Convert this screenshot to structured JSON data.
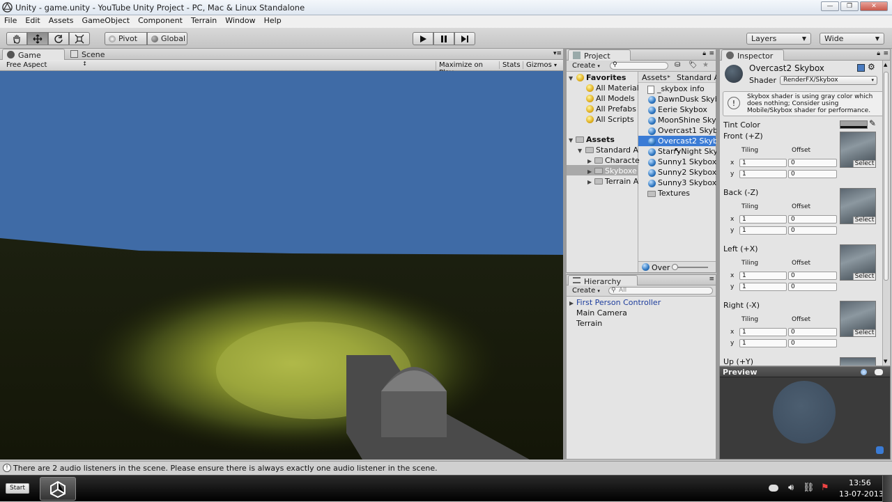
{
  "window": {
    "title": "Unity - game.unity - YouTube Unity Project - PC, Mac & Linux Standalone",
    "controls": [
      "—",
      "❐",
      "✕"
    ]
  },
  "menu": [
    "File",
    "Edit",
    "Assets",
    "GameObject",
    "Component",
    "Terrain",
    "Window",
    "Help"
  ],
  "toolbar": {
    "pivot": "Pivot",
    "global": "Global",
    "layers": "Layers",
    "layout": "Wide"
  },
  "game_panel": {
    "tab_game": "Game",
    "tab_scene": "Scene",
    "aspect": "Free Aspect",
    "maximize": "Maximize on Play",
    "stats": "Stats",
    "gizmos": "Gizmos"
  },
  "project": {
    "tab": "Project",
    "create": "Create",
    "favorites_label": "Favorites",
    "favorites": [
      "All Material",
      "All Models",
      "All Prefabs",
      "All Scripts"
    ],
    "assets_label": "Assets",
    "tree": [
      "Standard A",
      "Characte",
      "Skyboxe",
      "Terrain A"
    ],
    "breadcrumb": [
      "Assets",
      "Standard A"
    ],
    "files": [
      "_skybox info",
      "DawnDusk Skyb",
      "Eerie Skybox",
      "MoonShine Skyb",
      "Overcast1 Skyb",
      "Overcast2 Skyb",
      "StarryNight Sky",
      "Sunny1 Skybox",
      "Sunny2 Skybox",
      "Sunny3 Skybox",
      "Textures"
    ],
    "selected_file": "Overcast2 Skyb",
    "footer": "Over"
  },
  "hierarchy": {
    "tab": "Hierarchy",
    "create": "Create",
    "search_placeholder": "All",
    "items": [
      "First Person Controller",
      "Main Camera",
      "Terrain"
    ]
  },
  "inspector": {
    "tab": "Inspector",
    "title": "Overcast2 Skybox",
    "shader_label": "Shader",
    "shader_value": "RenderFX/Skybox",
    "warning": [
      "Skybox shader is using gray color which",
      "does nothing; Consider using",
      "Mobile/Skybox shader for performance."
    ],
    "tint_label": "Tint Color",
    "tiling_label": "Tiling",
    "offset_label": "Offset",
    "x_label": "x",
    "y_label": "y",
    "select_label": "Select",
    "faces": [
      {
        "name": "Front (+Z)",
        "tiling_x": "1",
        "offset_x": "0",
        "tiling_y": "1",
        "offset_y": "0"
      },
      {
        "name": "Back (-Z)",
        "tiling_x": "1",
        "offset_x": "0",
        "tiling_y": "1",
        "offset_y": "0"
      },
      {
        "name": "Left (+X)",
        "tiling_x": "1",
        "offset_x": "0",
        "tiling_y": "1",
        "offset_y": "0"
      },
      {
        "name": "Right (-X)",
        "tiling_x": "1",
        "offset_x": "0",
        "tiling_y": "1",
        "offset_y": "0"
      },
      {
        "name": "Up (+Y)"
      }
    ],
    "preview_label": "Preview"
  },
  "status": {
    "message": "There are 2 audio listeners in the scene. Please ensure there is always exactly one audio listener in the scene."
  },
  "taskbar": {
    "start": "Start",
    "time": "13:56",
    "date": "13-07-2013"
  },
  "colors": {
    "sky": "#3f6ba6",
    "selection": "#3a7bd5",
    "panel": "#e4e4e4"
  }
}
